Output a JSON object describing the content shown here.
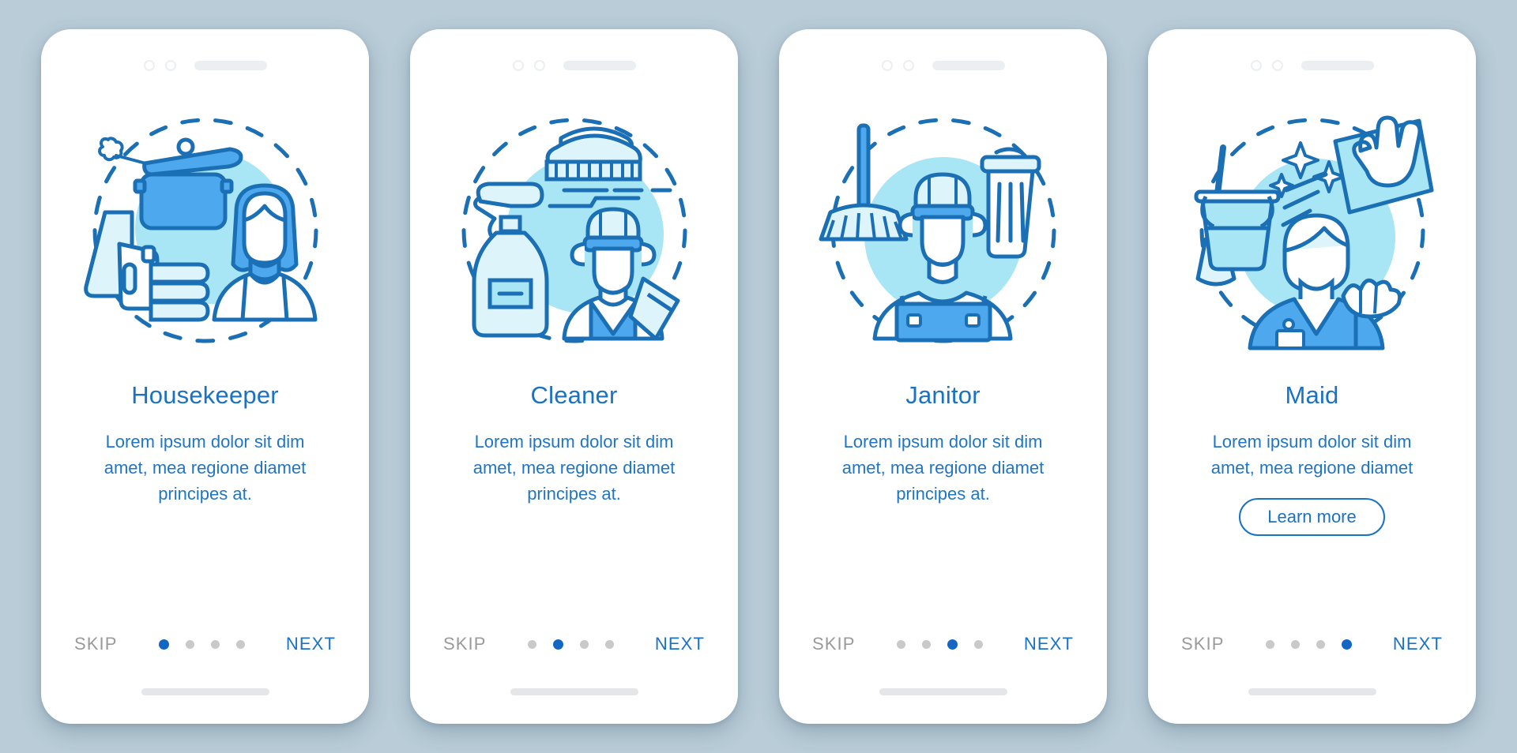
{
  "background_color": "#b9ccd8",
  "theme": {
    "accent": "#1a72c4",
    "text_blue": "#2076c6",
    "muted": "#9a9a9a",
    "dot_inactive": "#c9c9c9",
    "dot_active": "#1466c4",
    "illo_fill_light": "#a8e5f5",
    "illo_fill_mid": "#4da8ee",
    "illo_stroke": "#1b6fb5",
    "card_bg": "#ffffff"
  },
  "screens": [
    {
      "illustration": "housekeeper-illustration",
      "title": "Housekeeper",
      "description": "Lorem ipsum dolor sit dim amet, mea regione diamet principes at.",
      "skip_label": "SKIP",
      "next_label": "NEXT",
      "dots": 4,
      "active_dot": 1,
      "learn_more_label": null
    },
    {
      "illustration": "cleaner-illustration",
      "title": "Cleaner",
      "description": "Lorem ipsum dolor sit dim amet, mea regione diamet principes at.",
      "skip_label": "SKIP",
      "next_label": "NEXT",
      "dots": 4,
      "active_dot": 2,
      "learn_more_label": null
    },
    {
      "illustration": "janitor-illustration",
      "title": "Janitor",
      "description": "Lorem ipsum dolor sit dim amet, mea regione diamet principes at.",
      "skip_label": "SKIP",
      "next_label": "NEXT",
      "dots": 4,
      "active_dot": 3,
      "learn_more_label": null
    },
    {
      "illustration": "maid-illustration",
      "title": "Maid",
      "description": "Lorem ipsum dolor sit dim amet, mea regione diamet",
      "skip_label": "SKIP",
      "next_label": "NEXT",
      "dots": 4,
      "active_dot": 4,
      "learn_more_label": "Learn more"
    }
  ]
}
